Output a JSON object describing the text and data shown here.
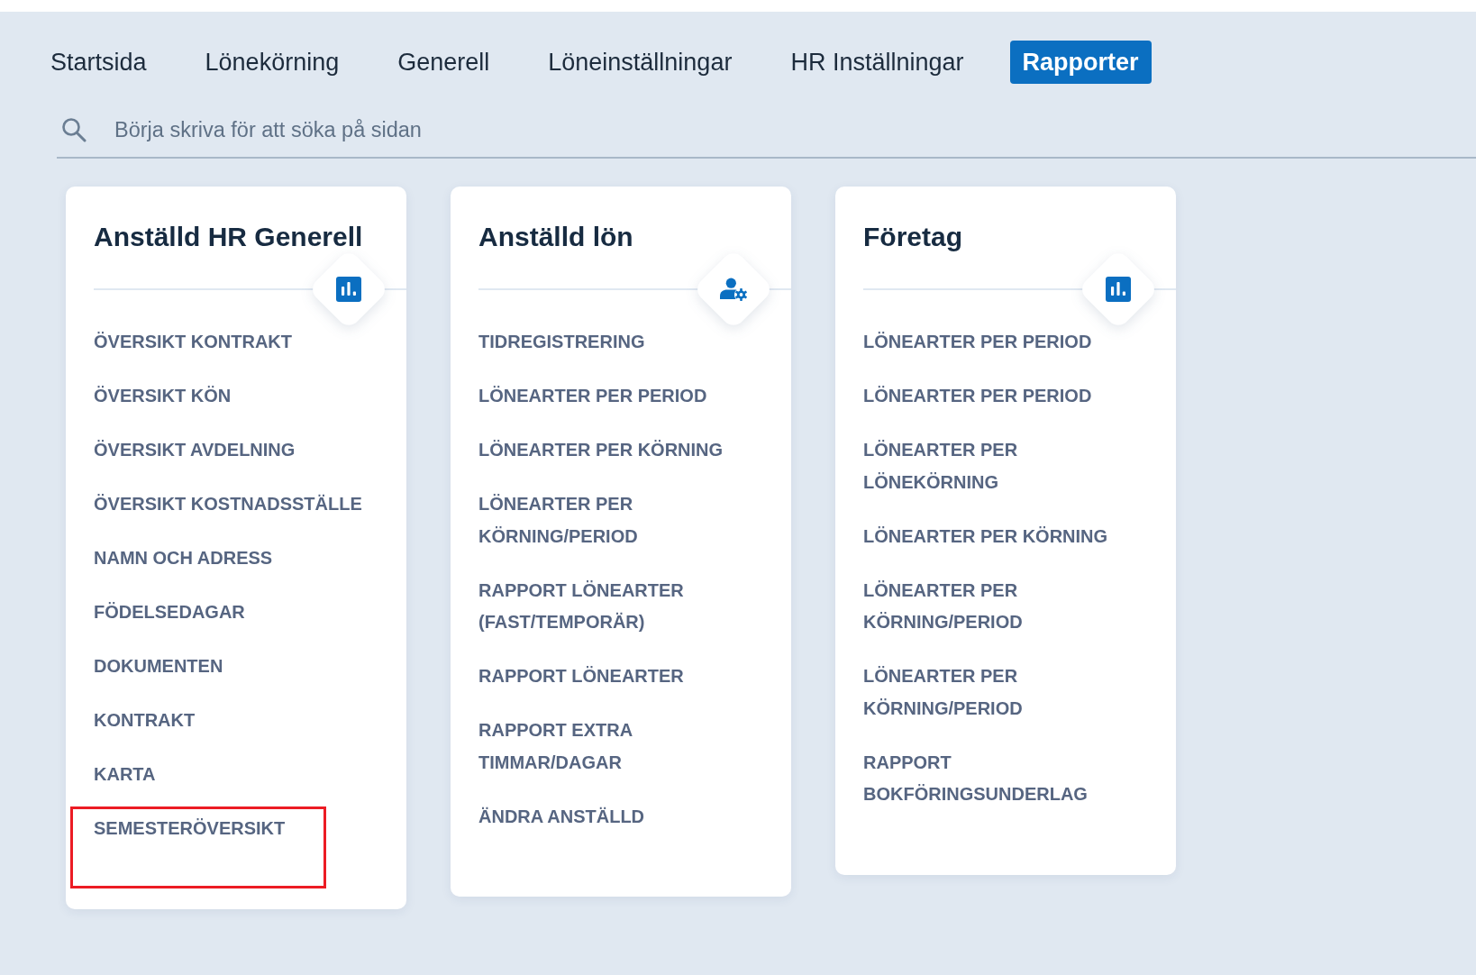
{
  "nav": {
    "tabs": [
      {
        "label": "Startsida",
        "selected": false
      },
      {
        "label": "Lönekörning",
        "selected": false
      },
      {
        "label": "Generell",
        "selected": false
      },
      {
        "label": "Löneinställningar",
        "selected": false
      },
      {
        "label": "HR Inställningar",
        "selected": false
      },
      {
        "label": "Rapporter",
        "selected": true
      }
    ]
  },
  "search": {
    "placeholder": "Börja skriva för att söka på sidan"
  },
  "cards": [
    {
      "title": "Anställd HR Generell",
      "kind": "statistics",
      "items": [
        {
          "label": "ÖVERSIKT KONTRAKT",
          "highlighted": false
        },
        {
          "label": "ÖVERSIKT KÖN",
          "highlighted": false
        },
        {
          "label": "ÖVERSIKT AVDELNING",
          "highlighted": false
        },
        {
          "label": "ÖVERSIKT KOSTNADSSTÄLLE",
          "highlighted": false
        },
        {
          "label": "NAMN OCH ADRESS",
          "highlighted": false
        },
        {
          "label": "FÖDELSEDAGAR",
          "highlighted": false
        },
        {
          "label": "DOKUMENTEN",
          "highlighted": false
        },
        {
          "label": "KONTRAKT",
          "highlighted": false
        },
        {
          "label": "KARTA",
          "highlighted": false
        },
        {
          "label": "SEMESTERÖVERSIKT",
          "highlighted": true
        }
      ]
    },
    {
      "title": "Anställd lön",
      "kind": "employee",
      "items": [
        {
          "label": "TIDREGISTRERING",
          "highlighted": false
        },
        {
          "label": "LÖNEARTER PER PERIOD",
          "highlighted": false
        },
        {
          "label": "LÖNEARTER PER KÖRNING",
          "highlighted": false
        },
        {
          "label": "LÖNEARTER PER KÖRNING/PERIOD",
          "highlighted": false
        },
        {
          "label": "RAPPORT LÖNEARTER (FAST/TEMPORÄR)",
          "highlighted": false
        },
        {
          "label": "RAPPORT LÖNEARTER",
          "highlighted": false
        },
        {
          "label": "RAPPORT EXTRA TIMMAR/DAGAR",
          "highlighted": false
        },
        {
          "label": "ÄNDRA ANSTÄLLD",
          "highlighted": false
        }
      ]
    },
    {
      "title": "Företag",
      "kind": "statistics",
      "items": [
        {
          "label": "LÖNEARTER PER PERIOD",
          "highlighted": false
        },
        {
          "label": "LÖNEARTER PER PERIOD",
          "highlighted": false
        },
        {
          "label": "LÖNEARTER PER LÖNEKÖRNING",
          "highlighted": false
        },
        {
          "label": "LÖNEARTER PER KÖRNING",
          "highlighted": false
        },
        {
          "label": "LÖNEARTER PER KÖRNING/PERIOD",
          "highlighted": false
        },
        {
          "label": "LÖNEARTER PER KÖRNING/PERIOD",
          "highlighted": false
        },
        {
          "label": "RAPPORT BOKFÖRINGSUNDERLAG",
          "highlighted": false
        }
      ]
    }
  ]
}
